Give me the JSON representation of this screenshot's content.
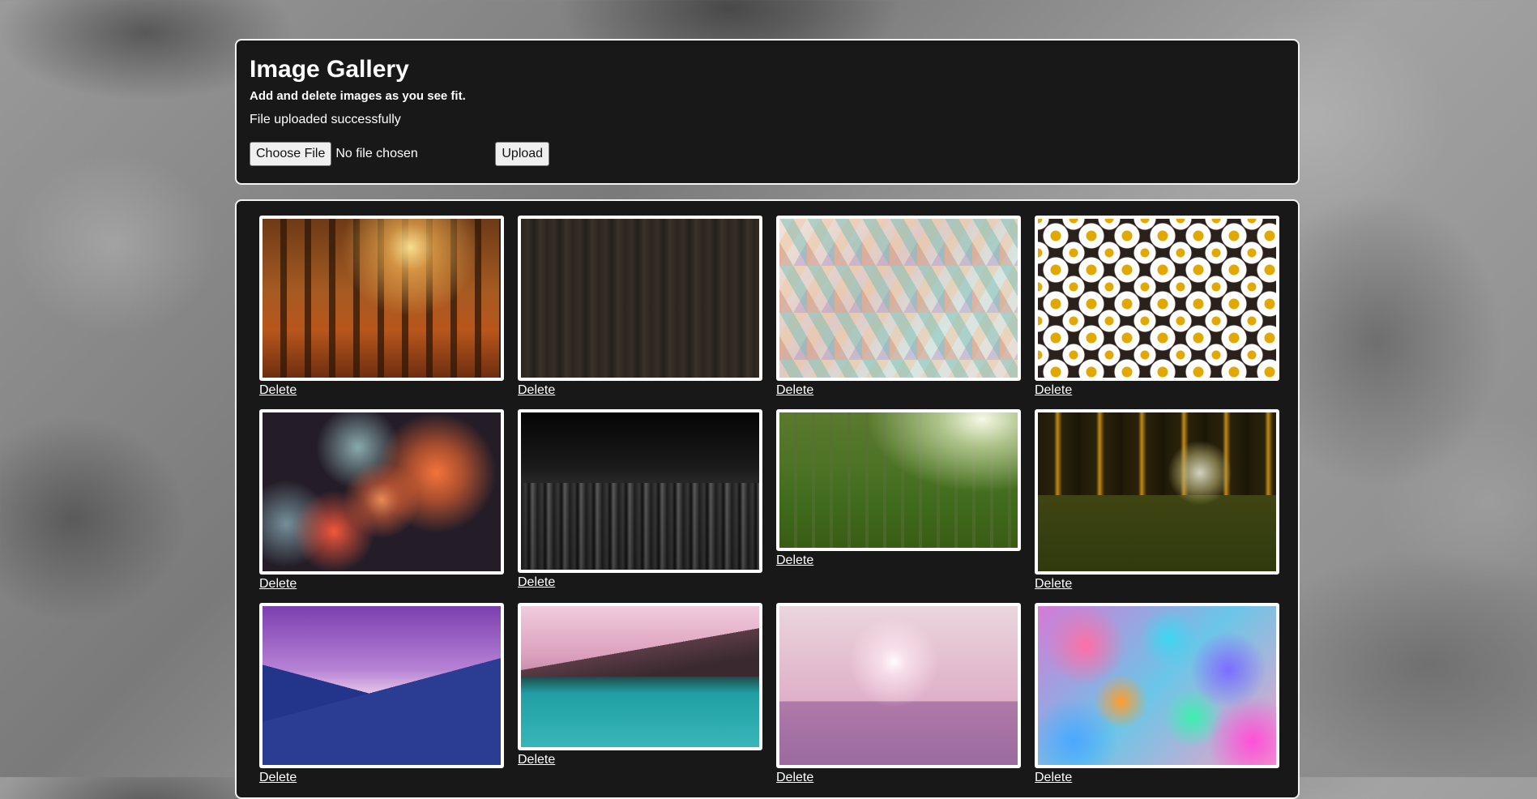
{
  "header": {
    "title": "Image Gallery",
    "subtitle": "Add and delete images as you see fit.",
    "status_message": "File uploaded successfully"
  },
  "upload_form": {
    "choose_file_label": "Choose File",
    "file_status": "No file chosen",
    "upload_label": "Upload"
  },
  "gallery": {
    "delete_label": "Delete",
    "images": [
      {
        "name": "forest-sunlight-image",
        "alt": "Sunlit autumn forest"
      },
      {
        "name": "dark-wood-image",
        "alt": "Dark wood grain"
      },
      {
        "name": "pastel-mosaic-image",
        "alt": "Pastel geometric mosaic"
      },
      {
        "name": "daisies-image",
        "alt": "White daisies"
      },
      {
        "name": "fireworks-image",
        "alt": "Fireworks"
      },
      {
        "name": "night-city-image",
        "alt": "Black and white city at night"
      },
      {
        "name": "green-forest-image",
        "alt": "Green mossy forest"
      },
      {
        "name": "glass-ball-image",
        "alt": "Glass ball on moss"
      },
      {
        "name": "purple-mountains-image",
        "alt": "Purple sky over mountains"
      },
      {
        "name": "mountain-lake-image",
        "alt": "Mountain lake"
      },
      {
        "name": "pink-city-image",
        "alt": "Pink hazy skyline"
      },
      {
        "name": "bokeh-image",
        "alt": "Colorful bokeh"
      }
    ]
  }
}
